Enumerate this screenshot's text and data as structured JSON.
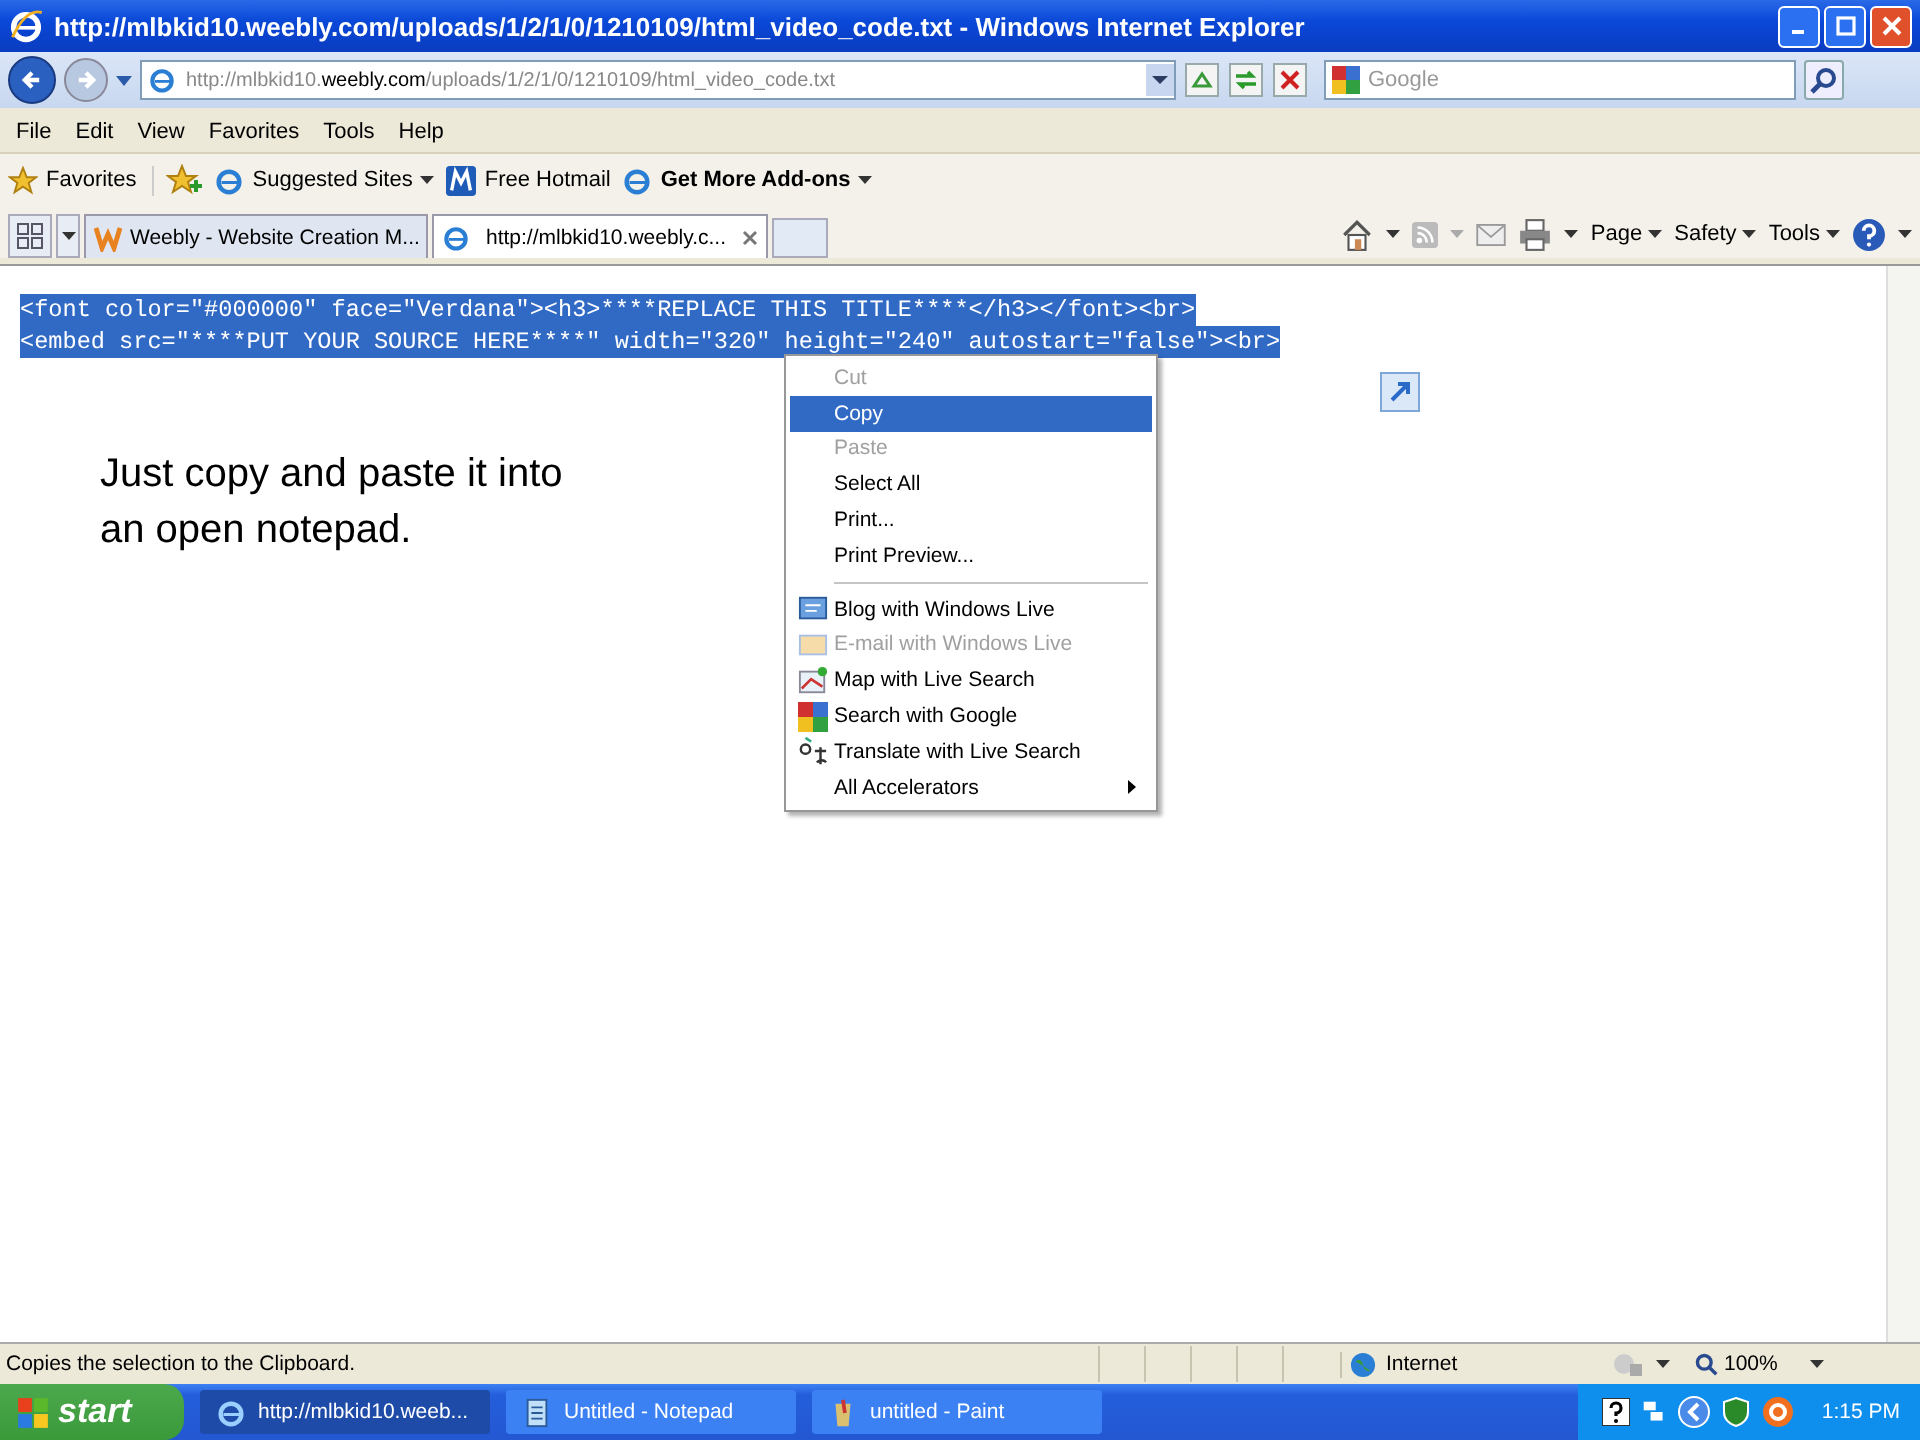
{
  "window": {
    "title": "http://mlbkid10.weebly.com/uploads/1/2/1/0/1210109/html_video_code.txt - Windows Internet Explorer"
  },
  "address": {
    "before": "http://mlbkid10.",
    "domain": "weebly.com",
    "after": "/uploads/1/2/1/0/1210109/html_video_code.txt"
  },
  "search": {
    "placeholder": "Google"
  },
  "menu_bar": [
    "File",
    "Edit",
    "View",
    "Favorites",
    "Tools",
    "Help"
  ],
  "favorites_bar": [
    {
      "label": "Favorites",
      "kind": "star",
      "dropdown": false
    },
    {
      "label": "Suggested Sites",
      "kind": "ie",
      "dropdown": true
    },
    {
      "label": "Free Hotmail",
      "kind": "hotmail",
      "dropdown": false
    },
    {
      "label": "Get More Add-ons",
      "kind": "ie",
      "dropdown": true
    }
  ],
  "tabs": [
    {
      "label": "Weebly - Website Creation M...",
      "kind": "weebly",
      "selected": false
    },
    {
      "label": "http://mlbkid10.weebly.c...",
      "kind": "ie",
      "selected": true
    }
  ],
  "command_bar": [
    "Page",
    "Safety",
    "Tools"
  ],
  "code_lines": [
    "<font color=\"#000000\" face=\"Verdana\"><h3>****REPLACE THIS TITLE****</h3></font><br>",
    "<embed src=\"****PUT YOUR SOURCE HERE****\" width=\"320\" height=\"240\" autostart=\"false\"><br>"
  ],
  "note": "Just copy and paste it into an open notepad.",
  "context_menu": [
    {
      "kind": "item",
      "label": "Cut",
      "disabled": true,
      "selected": false,
      "submenu": false
    },
    {
      "kind": "item",
      "label": "Copy",
      "disabled": false,
      "selected": true,
      "submenu": false
    },
    {
      "kind": "item",
      "label": "Paste",
      "disabled": true,
      "selected": false,
      "submenu": false
    },
    {
      "kind": "item",
      "label": "Select All",
      "disabled": false,
      "selected": false,
      "submenu": false
    },
    {
      "kind": "item",
      "label": "Print...",
      "disabled": false,
      "selected": false,
      "submenu": false
    },
    {
      "kind": "item",
      "label": "Print Preview...",
      "disabled": false,
      "selected": false,
      "submenu": false
    },
    {
      "kind": "separator"
    },
    {
      "kind": "blog",
      "label": "Blog with Windows Live",
      "disabled": false,
      "selected": false,
      "submenu": false
    },
    {
      "kind": "email",
      "label": "E-mail with Windows Live",
      "disabled": true,
      "selected": false,
      "submenu": false
    },
    {
      "kind": "map",
      "label": "Map with Live Search",
      "disabled": false,
      "selected": false,
      "submenu": false
    },
    {
      "kind": "google",
      "label": "Search with Google",
      "disabled": false,
      "selected": false,
      "submenu": false
    },
    {
      "kind": "translate",
      "label": "Translate with Live Search",
      "disabled": false,
      "selected": false,
      "submenu": false
    },
    {
      "kind": "item",
      "label": "All Accelerators",
      "disabled": false,
      "selected": false,
      "submenu": true
    }
  ],
  "status_bar": {
    "message": "Copies the selection to the Clipboard.",
    "zone": "Internet",
    "zoom": "100%"
  },
  "taskbar": {
    "start": "start",
    "tasks": [
      {
        "label": "http://mlbkid10.weeb...",
        "kind": "ie"
      },
      {
        "label": "Untitled - Notepad",
        "kind": "notepad"
      },
      {
        "label": "untitled - Paint",
        "kind": "paint"
      }
    ],
    "clock": "1:15 PM"
  }
}
